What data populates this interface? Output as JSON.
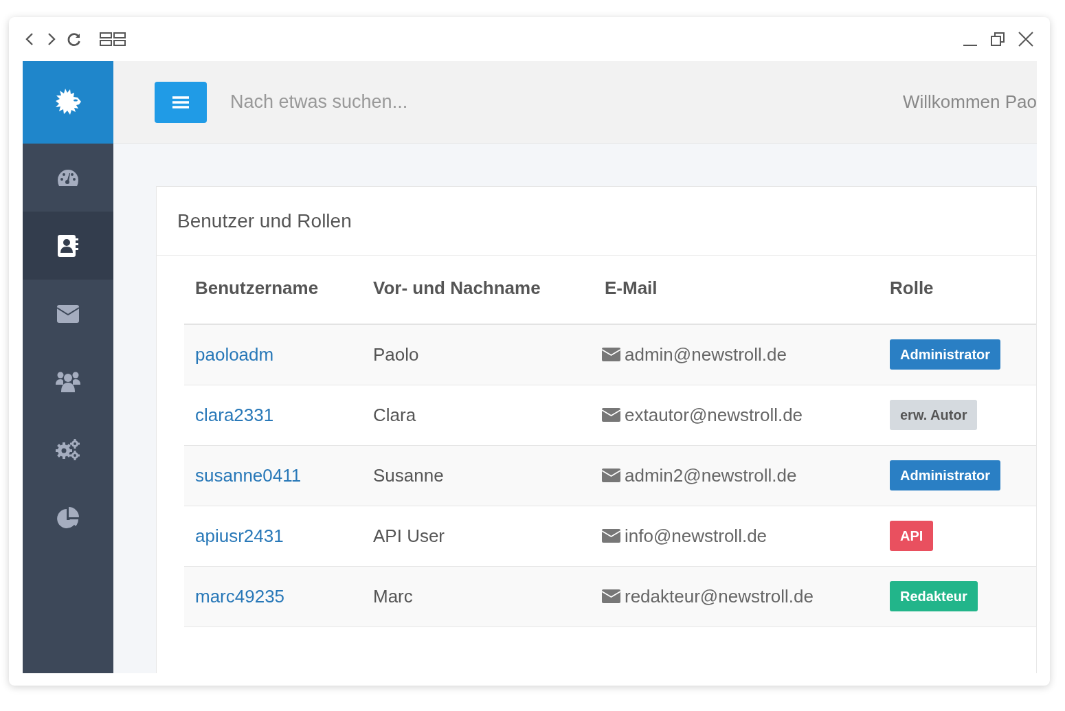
{
  "sidebar": {
    "items": [
      {
        "selected": false
      },
      {
        "selected": true
      },
      {
        "selected": false
      },
      {
        "selected": false
      },
      {
        "selected": false
      },
      {
        "selected": false
      }
    ]
  },
  "topbar": {
    "search": {
      "placeholder": "Nach etwas suchen..."
    },
    "welcome": "Willkommen Pao"
  },
  "card": {
    "title": "Benutzer und Rollen",
    "table": {
      "columns": [
        "Benutzername",
        "Vor- und Nachname",
        "E-Mail",
        "Rolle"
      ],
      "rows": [
        {
          "username": "paoloadm",
          "name": "Paolo",
          "email": "admin@newstroll.de",
          "role": "Administrator",
          "color": "#2a7fc4"
        },
        {
          "username": "clara2331",
          "name": "Clara",
          "email": "extautor@newstroll.de",
          "role": "erw. Autor",
          "color": "#d5dadf"
        },
        {
          "username": "susanne0411",
          "name": "Susanne",
          "email": "admin2@newstroll.de",
          "role": "Administrator",
          "color": "#2a7fc4"
        },
        {
          "username": "apiusr2431",
          "name": "API User",
          "email": "info@newstroll.de",
          "role": "API",
          "color": "#e9505f"
        },
        {
          "username": "marc49235",
          "name": "Marc",
          "email": "redakteur@newstroll.de",
          "role": "Redakteur",
          "color": "#22b58a"
        }
      ]
    }
  }
}
